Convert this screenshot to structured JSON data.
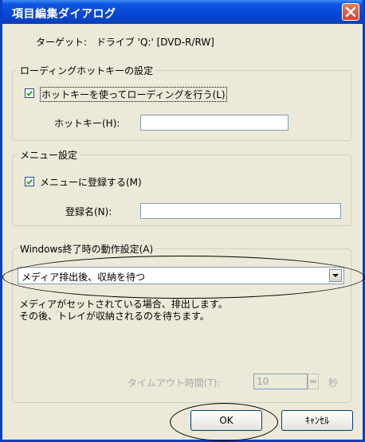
{
  "window": {
    "title": "項目編集ダイアログ"
  },
  "target": {
    "label": "ターゲット:",
    "value": "ドライブ 'Q:' [DVD-R/RW]"
  },
  "loading_group": {
    "legend": "ローディングホットキーの設定",
    "checkbox_label": "ホットキーを使ってローディングを行う(L)",
    "checked": true,
    "hotkey_label": "ホットキー(H):",
    "hotkey_value": ""
  },
  "menu_group": {
    "legend": "メニュー設定",
    "checkbox_label": "メニューに登録する(M)",
    "checked": true,
    "name_label": "登録名(N):",
    "name_value": ""
  },
  "shutdown_group": {
    "legend": "Windows終了時の動作設定(A)",
    "selected": "メディア排出後、収納を待つ",
    "desc_line1": "メディアがセットされている場合、排出します。",
    "desc_line2": "その後、トレイが収納されるのを待ちます。",
    "timeout_label": "タイムアウト時間(T):",
    "timeout_value": "10",
    "timeout_unit": "秒"
  },
  "buttons": {
    "ok": "OK",
    "cancel": "ｷｬﾝｾﾙ"
  },
  "colors": {
    "titlebar": "#0846d6",
    "dialog_bg": "#ece9d8",
    "close": "#d44426"
  }
}
